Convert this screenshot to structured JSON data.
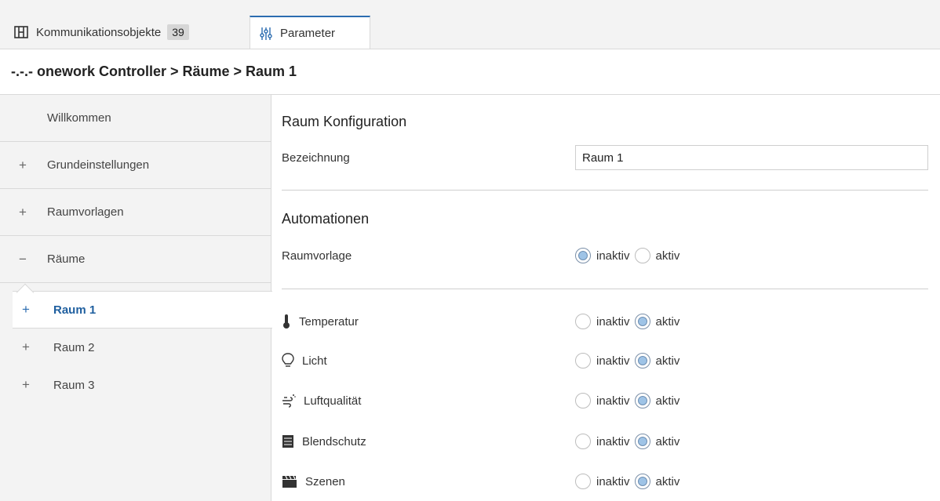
{
  "tabs": {
    "comm_label": "Kommunikationsobjekte",
    "comm_count": "39",
    "param_label": "Parameter"
  },
  "breadcrumb": "-.-.- onework Controller > Räume > Raum 1",
  "sidebar": {
    "items": [
      {
        "sign": "",
        "label": "Willkommen"
      },
      {
        "sign": "+",
        "label": "Grundeinstellungen"
      },
      {
        "sign": "+",
        "label": "Raumvorlagen"
      },
      {
        "sign": "−",
        "label": "Räume"
      }
    ],
    "sub_items": [
      {
        "sign": "+",
        "label": "Raum 1"
      },
      {
        "sign": "+",
        "label": "Raum 2"
      },
      {
        "sign": "+",
        "label": "Raum 3"
      }
    ]
  },
  "main": {
    "section1_title": "Raum Konfiguration",
    "bezeichnung_label": "Bezeichnung",
    "bezeichnung_value": "Raum 1",
    "section2_title": "Automationen",
    "raumvorlage_label": "Raumvorlage",
    "option_inactive": "inaktiv",
    "option_active": "aktiv",
    "raumvorlage_selected": "inaktiv",
    "automations": [
      {
        "icon": "thermometer-icon",
        "label": "Temperatur",
        "selected": "aktiv"
      },
      {
        "icon": "lightbulb-icon",
        "label": "Licht",
        "selected": "aktiv"
      },
      {
        "icon": "air-quality-icon",
        "label": "Luftqualität",
        "selected": "aktiv"
      },
      {
        "icon": "blind-icon",
        "label": "Blendschutz",
        "selected": "aktiv"
      },
      {
        "icon": "scene-clapper-icon",
        "label": "Szenen",
        "selected": "aktiv"
      }
    ]
  },
  "colors": {
    "accent": "#2b6cb0",
    "radio_fill": "#9ec3e6",
    "sidebar_bg": "#f3f3f3"
  }
}
